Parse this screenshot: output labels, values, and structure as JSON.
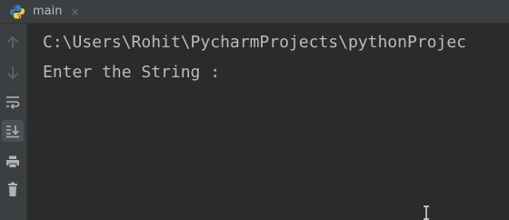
{
  "tab": {
    "title": "main",
    "close_glyph": "×",
    "icon": "python-icon"
  },
  "toolbar": {
    "items": [
      {
        "name": "up-arrow-icon",
        "active": false
      },
      {
        "name": "down-arrow-icon",
        "active": false
      },
      {
        "name": "soft-wrap-icon",
        "active": false
      },
      {
        "name": "scroll-to-end-icon",
        "active": true
      },
      {
        "name": "print-icon",
        "active": false
      },
      {
        "name": "trash-icon",
        "active": false
      }
    ]
  },
  "console": {
    "lines": [
      "C:\\Users\\Rohit\\PycharmProjects\\pythonProjec",
      "Enter the String :"
    ]
  },
  "colors": {
    "background": "#2b2b2b",
    "panel": "#3c3f41",
    "text": "#bbbbbb",
    "icon": "#8c9094",
    "python_blue": "#3d7ab8",
    "python_yellow": "#f2c94c"
  }
}
